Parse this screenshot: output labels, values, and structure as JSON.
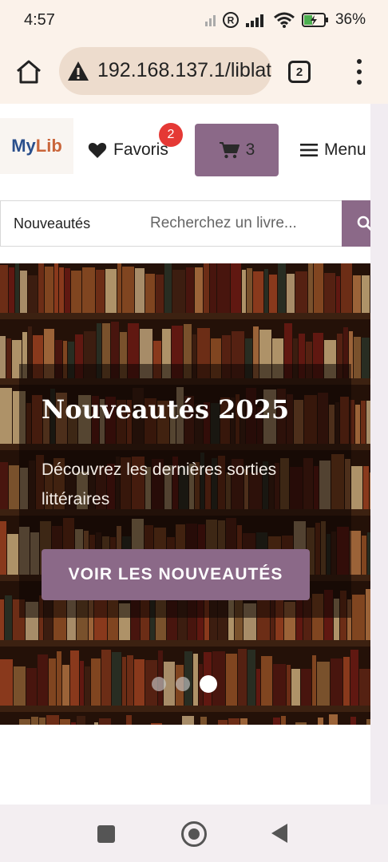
{
  "status_bar": {
    "time": "4:57",
    "battery": "36%"
  },
  "browser": {
    "url": "192.168.137.1/liblat",
    "tab_count": "2"
  },
  "site": {
    "logo_my": "My",
    "logo_lib": "Lib",
    "favorites_label": "Favoris",
    "favorites_badge": "2",
    "cart_count": "3",
    "menu_label": "Menu"
  },
  "search": {
    "category": "Nouveautés",
    "placeholder": "Recherchez un livre..."
  },
  "hero": {
    "title": "Nouveautés 2025",
    "subtitle": "Découvrez les dernières sorties littéraires",
    "cta": "VOIR LES NOUVEAUTÉS",
    "slides": 3,
    "active_slide": 3
  },
  "colors": {
    "accent": "#8b6988",
    "badge": "#e53935"
  }
}
